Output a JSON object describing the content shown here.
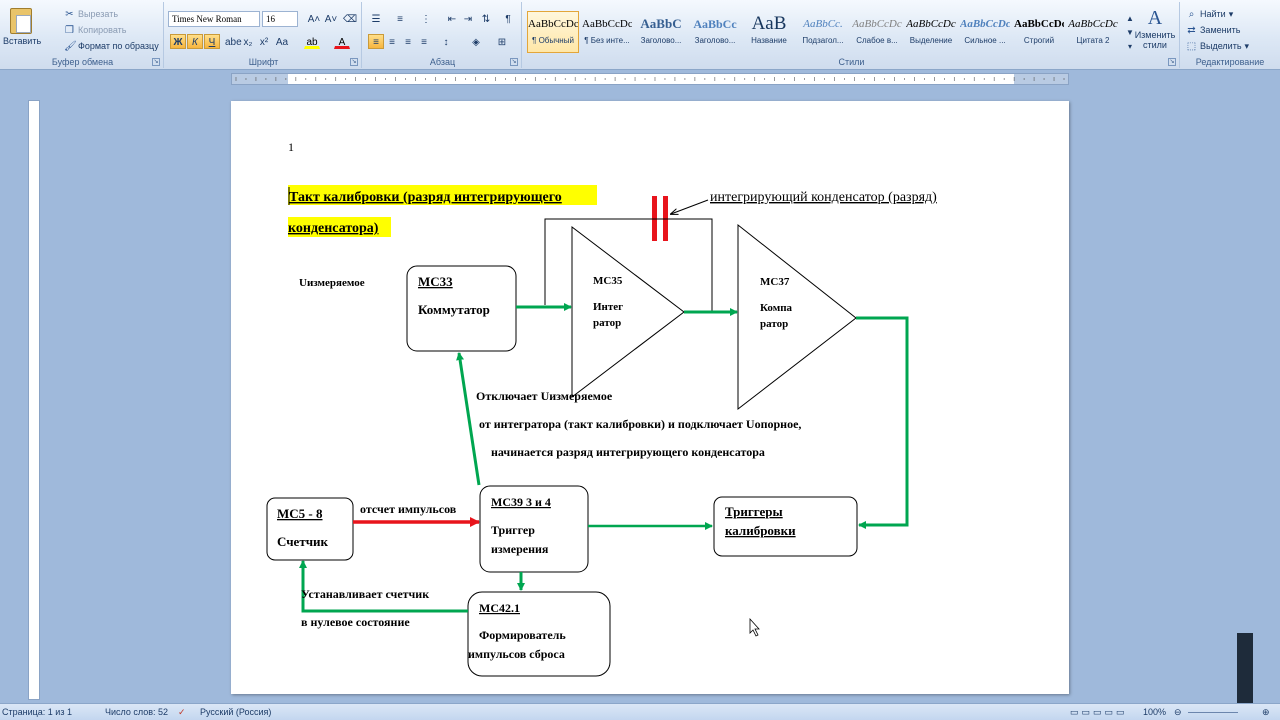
{
  "clipboard": {
    "paste_label": "Вставить",
    "cut_label": "Вырезать",
    "copy_label": "Копировать",
    "format_painter_label": "Формат по образцу",
    "group_title": "Буфер обмена"
  },
  "font": {
    "name": "Times New Roman",
    "size": "16",
    "group_title": "Шрифт",
    "bold_glyph": "Ж",
    "italic_glyph": "К",
    "underline_glyph": "Ч"
  },
  "paragraph": {
    "group_title": "Абзац"
  },
  "styles": {
    "group_title": "Стили",
    "change_label": "Изменить стили",
    "items": [
      {
        "sample": "AaBbCcDc",
        "label": "¶ Обычный"
      },
      {
        "sample": "AaBbCcDc",
        "label": "¶ Без инте..."
      },
      {
        "sample": "AaBbC",
        "label": "Заголово..."
      },
      {
        "sample": "AaBbCc",
        "label": "Заголово..."
      },
      {
        "sample": "AaB",
        "label": "Название"
      },
      {
        "sample": "AaBbCc.",
        "label": "Подзагол..."
      },
      {
        "sample": "AaBbCcDc",
        "label": "Слабое в..."
      },
      {
        "sample": "AaBbCcDc",
        "label": "Выделение"
      },
      {
        "sample": "AaBbCcDc",
        "label": "Сильное ..."
      },
      {
        "sample": "AaBbCcDc",
        "label": "Строгий"
      },
      {
        "sample": "AaBbCcDc",
        "label": "Цитата 2"
      }
    ]
  },
  "editing": {
    "group_title": "Редактирование",
    "find_label": "Найти",
    "replace_label": "Заменить",
    "select_label": "Выделить"
  },
  "document": {
    "page_number": "1",
    "title_line1": "Такт калибровки (разряд  интегрирующего",
    "title_line2": "конденсатора)",
    "capacitor_label": "интегрирующий конденсатор  (разряд)",
    "u_measured": "Uизмеряемое",
    "mc33_title": "MC33",
    "mc33_name": "Коммутатор",
    "mc35_title": "MC35",
    "mc35_name1": "Интег",
    "mc35_name2": "ратор",
    "mc37_title": "MC37",
    "mc37_name1": "Компа",
    "mc37_name2": "ратор",
    "note_line1": "Отключает Uизмеряемое",
    "note_line2": "от интегратора (такт калибровки)  и подключает Uопорное,",
    "note_line3": "начинается разряд интегрирующего конденсатора",
    "mc58_title": "MC5 - 8",
    "mc58_name": "Счетчик",
    "count_label": "отсчет импульсов",
    "mc39_title": "MC39 3 и 4",
    "mc39_name1": "Триггер",
    "mc39_name2": "измерения",
    "triggers_name1": "Триггеры",
    "triggers_name2": "калибровки",
    "reset_line1": "Устанавливает счетчик",
    "reset_line2": "в нулевое состояние",
    "mc42_title": "MC42.1",
    "mc42_name1": "Формирователь",
    "mc42_name2": "импульсов сброса"
  },
  "status": {
    "page": "Страница: 1 из 1",
    "words": "Число слов: 52",
    "language": "Русский (Россия)",
    "zoom": "100%"
  },
  "colors": {
    "highlight": "#ffff00",
    "green_arrow": "#00a650",
    "red_arrow": "#e8141c",
    "capacitor": "#e8141c"
  }
}
